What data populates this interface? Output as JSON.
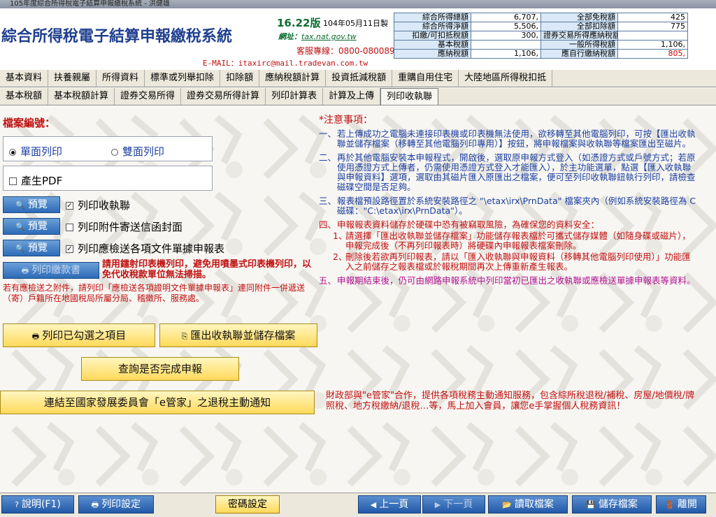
{
  "window": {
    "title": "105年度綜合所得稅電子結算申報繳稅系統 - 洪健雄"
  },
  "header": {
    "app_title": "綜合所得稅電子結算申報繳稅系統",
    "version": "16.22版",
    "date": "104年05月11日製",
    "website_label": "網址：",
    "website": "tax.nat.gov.tw",
    "hotline": "客服專線：0800-080089",
    "email": "E-MAIL：itaxirc@mail.tradevan.com.tw"
  },
  "summary": {
    "rows": [
      {
        "l1": "綜合所得總額",
        "v1": "6,707,",
        "l2": "全部免稅額",
        "v2": "425"
      },
      {
        "l1": "綜合所得淨額",
        "v1": "5,506,",
        "l2": "全部扣除額",
        "v2": "775"
      },
      {
        "l1": "扣繳/可扣抵稅額",
        "v1": "300,",
        "l2": "證券交易所得應納稅額",
        "v2": ""
      },
      {
        "l1": "基本稅額",
        "v1": "",
        "l2": "一般所得稅額",
        "v2": "1,106,"
      },
      {
        "l1": "應納稅額",
        "v1": "1,106,",
        "l2": "應自行繳納稅額",
        "v2": "805,"
      }
    ]
  },
  "tabs_row1": [
    "基本資料",
    "扶養親屬",
    "所得資料",
    "標準或列舉扣除",
    "扣除額",
    "應納稅額計算",
    "投資抵減稅額",
    "重購自用住宅",
    "大陸地區所得稅扣抵"
  ],
  "tabs_row2": [
    "基本稅額",
    "基本稅額計算",
    "證券交易所得",
    "證券交易所得計算",
    "列印計算表",
    "計算及上傳",
    "列印收執聯"
  ],
  "left": {
    "file_no_label": "檔案編號：",
    "single_print": "單面列印",
    "double_print": "雙面列印",
    "pdf": "產生PDF",
    "preview": "預覽",
    "row1": "列印收執聯",
    "row2": "列印附件寄送信函封面",
    "row3": "列印應檢送各項文件單據申報表",
    "print_payment": "列印繳款書",
    "red_note1": "請用鐳射印表機列印，避免用噴墨式印表機列印，以免代收稅款單位無法掃描。",
    "red_note2": "若有應檢送之附件，請列印「應檢送各項證明文件單據申報表」連同附件一併遞送（寄）戶籍所在地國稅局所屬分局、稽徵所、服務處。",
    "print_checked": "列印已勾選之項目",
    "export_receipt": "匯出收執聯並儲存檔案",
    "query_done": "查詢是否完成申報",
    "link_ndc": "連結至國家發展委員會「e管家」之退稅主動通知"
  },
  "notes": {
    "title": "*注意事項：",
    "items": [
      {
        "num": "一、",
        "text": "若上傳成功之電腦未連接印表機或印表機無法使用，欲移轉至其他電腦列印，可按【匯出收執聯並儲存檔案（移轉至其他電腦列印專用）】按鈕，將申報檔案與收執聯等檔案匯出至磁片。"
      },
      {
        "num": "二、",
        "text": "再於其他電腦安裝本申報程式，開啟後，選取原申報方式登入（如憑證方式或戶號方式；若原使用憑證方式上傳者，仍需使用憑證方式登入才能匯入），於主功能選單，點選【匯入收執聯與申報資料】選項，選取由其磁片匯入原匯出之檔案，便可至列印收執聯鈕執行列印，請檢查磁碟空間是否足夠。"
      },
      {
        "num": "三、",
        "text": "報表檔預設路徑置於系統安裝路徑之 \"\\etax\\irx\\PrnData\" 檔案夾內（例如系統安裝路徑為 C 磁碟：\"C:\\etax\\irx\\PrnData\"）。"
      },
      {
        "num": "四、",
        "text": "申報報表資料儲存於硬碟中恐有被竊取風險，為確保您的資料安全："
      },
      {
        "num": "五、",
        "text": "申報期結束後，仍可由網路申報系統中列印當初已匯出之收執聯或應檢送單據申報表等資料。"
      }
    ],
    "sub": [
      {
        "num": "1、",
        "text": "請選擇「匯出收執聯並儲存檔案」功能儲存報表檔於可攜式儲存媒體（如隨身碟或磁片），申報完成後（不再列印報表時）將硬碟內申報報表檔案刪除。"
      },
      {
        "num": "2、",
        "text": "刪除後若欲再列印報表，請以「匯入收執聯與申報資料（移轉其他電腦列印使用）」功能匯入之前儲存之報表檔或於報稅期間再次上傳重新產生報表。"
      }
    ],
    "efamily": "財政部與\"e管家\"合作，提供各項稅務主動通知服務，包含綜所稅退稅/補稅、房屋/地價稅/牌照稅、地方稅繳納/退稅…等，馬上加入會員，讓您e手掌握個人稅務資訊！"
  },
  "bottom": {
    "help": "說明(F1)",
    "print_settings": "列印設定",
    "password": "密碼設定",
    "prev_page": "上一頁",
    "next_page": "下一頁",
    "read_file": "讀取檔案",
    "save_file": "儲存檔案",
    "exit": "離開"
  }
}
